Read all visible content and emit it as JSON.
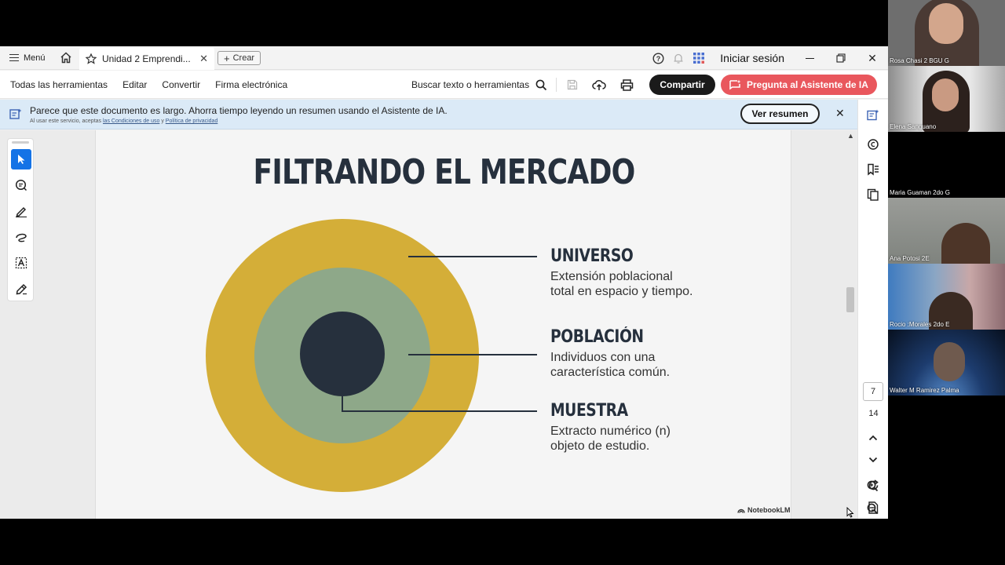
{
  "titlebar": {
    "menu_label": "Menú",
    "tab_title": "Unidad 2 Emprendi...",
    "create_label": "Crear",
    "signin_label": "Iniciar sesión"
  },
  "toolbar": {
    "all_tools": "Todas las herramientas",
    "edit": "Editar",
    "convert": "Convertir",
    "esign": "Firma electrónica",
    "search_tools": "Buscar texto o herramientas",
    "share": "Compartir",
    "ai_assistant": "Pregunta al Asistente de IA"
  },
  "banner": {
    "message": "Parece que este documento es largo. Ahorra tiempo leyendo un resumen usando el Asistente de IA.",
    "sub_prefix": "Al usar este servicio, aceptas",
    "terms_link": "las Condiciones de uso",
    "sub_and": "y",
    "privacy_link": "Política de privacidad",
    "summary_button": "Ver resumen"
  },
  "slide": {
    "title": "FILTRANDO EL MERCADO",
    "items": [
      {
        "heading": "UNIVERSO",
        "line1": "Extensión poblacional",
        "line2": "total en espacio y tiempo."
      },
      {
        "heading": "POBLACIÓN",
        "line1": "Individuos con una",
        "line2": "característica común."
      },
      {
        "heading": "MUESTRA",
        "line1": "Extracto numérico (n)",
        "line2": "objeto de estudio."
      }
    ],
    "watermark": "NotebookLM",
    "colors": {
      "outer": "#d4ae38",
      "middle": "#8ea889",
      "inner": "#26303d"
    }
  },
  "pagination": {
    "current": "7",
    "total": "14"
  },
  "participants": [
    {
      "name": "Rosa Chasi 2 BGU G"
    },
    {
      "name": "Elena Sanguano"
    },
    {
      "name": "Maria Guaman 2do G"
    },
    {
      "name": "Ana Potosi 2E"
    },
    {
      "name": "Rocio :Morales 2do E"
    },
    {
      "name": "Walter M Ramirez Palma"
    }
  ]
}
